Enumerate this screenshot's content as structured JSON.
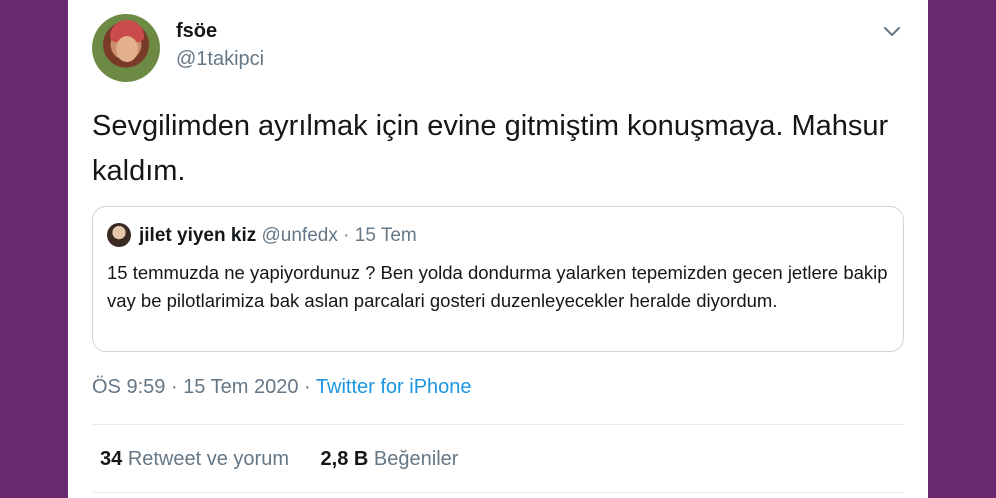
{
  "tweet": {
    "author_name": "fsöe",
    "author_handle": "@1takipci",
    "text": "Sevgilimden ayrılmak için evine gitmiştim konuşmaya. Mahsur kaldım.",
    "quoted": {
      "name": "jilet yiyen kiz",
      "handle": "@unfedx",
      "separator": "·",
      "date": "15 Tem",
      "text": "15 temmuzda ne yapiyordunuz ? Ben yolda dondurma yalarken tepemizden gecen jetlere bakip vay be pilotlarimiza bak aslan parcalari gosteri duzenleyecekler heralde diyordum."
    },
    "time": "ÖS 9:59",
    "meta_separator_1": "·",
    "date": "15 Tem 2020",
    "meta_separator_2": "·",
    "source": "Twitter for iPhone"
  },
  "stats": {
    "retweets_count": "34",
    "retweets_label": "Retweet ve yorum",
    "likes_count": "2,8 B",
    "likes_label": "Beğeniler"
  },
  "colors": {
    "background": "#6b2a70",
    "link": "#1b95e0",
    "muted": "#657786",
    "text": "#14171a"
  },
  "icons": {
    "menu": "chevron-down-icon"
  }
}
